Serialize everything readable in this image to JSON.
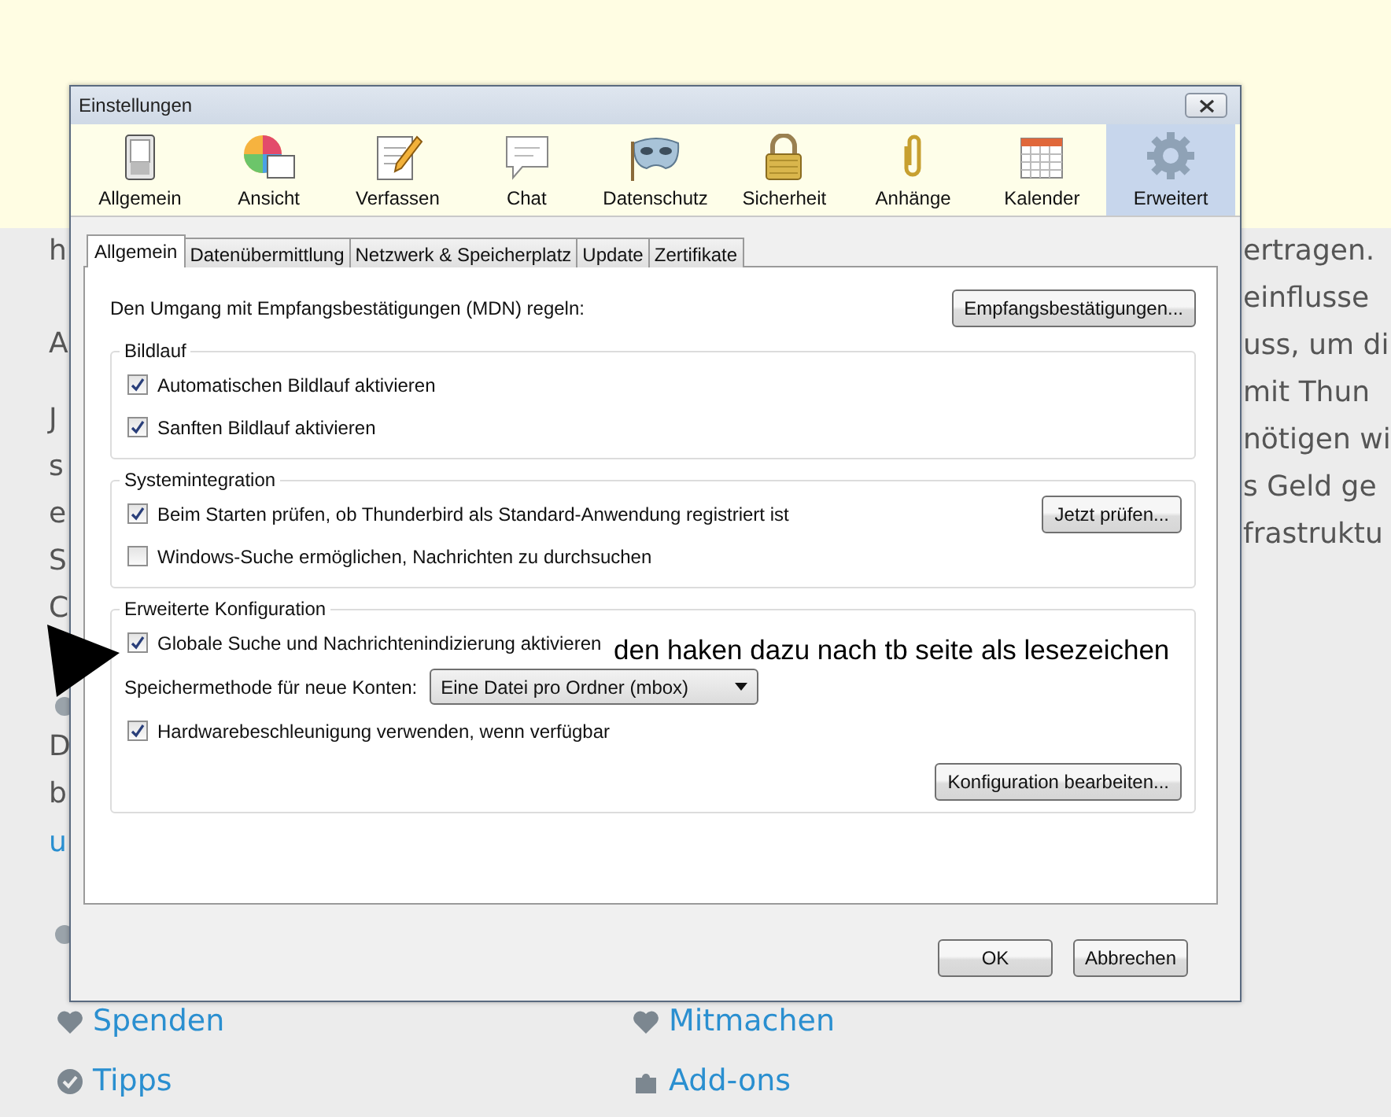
{
  "background_page": {
    "left_fragments": [
      {
        "text": "h",
        "link": false
      },
      {
        "text": "A",
        "link": false
      },
      {
        "text": "J",
        "link": false
      },
      {
        "text": "s",
        "link": false
      },
      {
        "text": "e",
        "link": false
      },
      {
        "text": "S",
        "link": false
      },
      {
        "text": "C",
        "link": false
      },
      {
        "text": "D",
        "link": false
      },
      {
        "text": "b",
        "link": false
      },
      {
        "text": "u",
        "link": true
      }
    ],
    "right_fragments": [
      "ertragen.",
      "einflusse",
      "uss, um di",
      "mit Thun",
      "nötigen wi",
      "s Geld ge",
      "frastruktu"
    ],
    "links": [
      "Spenden",
      "Mitmachen",
      "Tipps",
      "Add-ons"
    ]
  },
  "dialog": {
    "title": "Einstellungen",
    "toolbar": [
      {
        "label": "Allgemein",
        "selected": false
      },
      {
        "label": "Ansicht",
        "selected": false
      },
      {
        "label": "Verfassen",
        "selected": false
      },
      {
        "label": "Chat",
        "selected": false
      },
      {
        "label": "Datenschutz",
        "selected": false
      },
      {
        "label": "Sicherheit",
        "selected": false
      },
      {
        "label": "Anhänge",
        "selected": false
      },
      {
        "label": "Kalender",
        "selected": false
      },
      {
        "label": "Erweitert",
        "selected": true
      }
    ],
    "tabs": [
      {
        "label": "Allgemein",
        "selected": true
      },
      {
        "label": "Datenübermittlung",
        "selected": false
      },
      {
        "label": "Netzwerk & Speicherplatz",
        "selected": false
      },
      {
        "label": "Update",
        "selected": false
      },
      {
        "label": "Zertifikate",
        "selected": false
      }
    ],
    "mdn": {
      "label": "Den Umgang mit Empfangsbestätigungen (MDN) regeln:",
      "button": "Empfangsbestätigungen..."
    },
    "groups": [
      {
        "legend": "Bildlauf",
        "rows": [
          {
            "kind": "checkbox",
            "label": "Automatischen Bildlauf aktivieren",
            "checked": true
          },
          {
            "kind": "checkbox",
            "label": "Sanften Bildlauf aktivieren",
            "checked": true
          }
        ]
      },
      {
        "legend": "Systemintegration",
        "rows": [
          {
            "kind": "checkbox",
            "label": "Beim Starten prüfen, ob Thunderbird als Standard-Anwendung registriert ist",
            "checked": true,
            "button": "Jetzt prüfen..."
          },
          {
            "kind": "checkbox",
            "label": "Windows-Suche ermöglichen, Nachrichten zu durchsuchen",
            "checked": false
          }
        ]
      },
      {
        "legend": "Erweiterte Konfiguration",
        "rows": [
          {
            "kind": "checkbox",
            "label": "Globale Suche und Nachrichtenindizierung aktivieren",
            "checked": true
          },
          {
            "kind": "select",
            "label": "Speichermethode für neue Konten:",
            "value": "Eine Datei pro Ordner (mbox)"
          },
          {
            "kind": "checkbox",
            "label": "Hardwarebeschleunigung verwenden, wenn verfügbar",
            "checked": true
          },
          {
            "kind": "button",
            "label": "Konfiguration bearbeiten..."
          }
        ]
      }
    ],
    "buttons": [
      "OK",
      "Abbrechen"
    ]
  },
  "annotation": {
    "text": "den haken dazu nach tb seite als lesezeichen"
  }
}
